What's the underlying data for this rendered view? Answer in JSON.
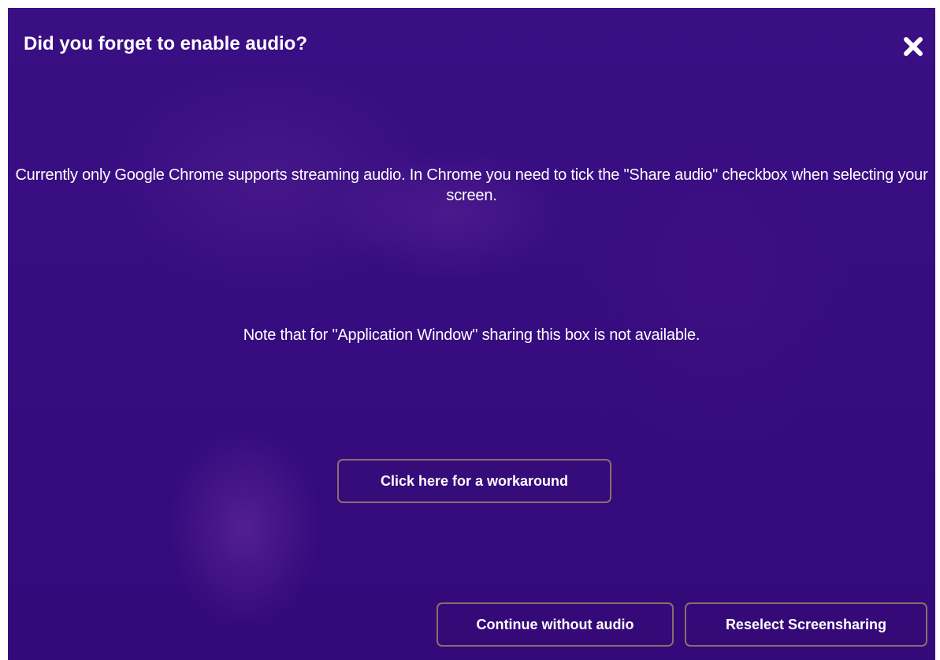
{
  "dialog": {
    "title": "Did you forget to enable audio?",
    "close_icon": "close-x-icon",
    "message_line_1": "Currently only Google Chrome supports streaming audio. In Chrome you need to tick the \"Share audio\" checkbox when selecting your screen.",
    "message_line_2": "Note that for \"Application Window\" sharing this box is not available.",
    "workaround_label": "Click here for a workaround",
    "continue_label": "Continue without audio",
    "reselect_label": "Reselect Screensharing"
  },
  "colors": {
    "background": "#370c80",
    "text": "#ffffff",
    "button_border": "#8b6e6a"
  }
}
